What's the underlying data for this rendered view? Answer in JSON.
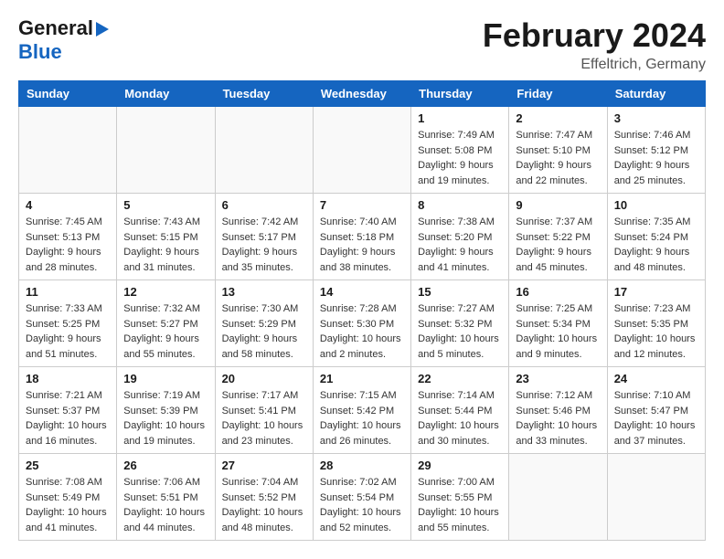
{
  "header": {
    "logo_general": "General",
    "logo_blue": "Blue",
    "main_title": "February 2024",
    "sub_title": "Effeltrich, Germany"
  },
  "weekdays": [
    "Sunday",
    "Monday",
    "Tuesday",
    "Wednesday",
    "Thursday",
    "Friday",
    "Saturday"
  ],
  "weeks": [
    [
      {
        "day": "",
        "info": ""
      },
      {
        "day": "",
        "info": ""
      },
      {
        "day": "",
        "info": ""
      },
      {
        "day": "",
        "info": ""
      },
      {
        "day": "1",
        "info": "Sunrise: 7:49 AM\nSunset: 5:08 PM\nDaylight: 9 hours\nand 19 minutes."
      },
      {
        "day": "2",
        "info": "Sunrise: 7:47 AM\nSunset: 5:10 PM\nDaylight: 9 hours\nand 22 minutes."
      },
      {
        "day": "3",
        "info": "Sunrise: 7:46 AM\nSunset: 5:12 PM\nDaylight: 9 hours\nand 25 minutes."
      }
    ],
    [
      {
        "day": "4",
        "info": "Sunrise: 7:45 AM\nSunset: 5:13 PM\nDaylight: 9 hours\nand 28 minutes."
      },
      {
        "day": "5",
        "info": "Sunrise: 7:43 AM\nSunset: 5:15 PM\nDaylight: 9 hours\nand 31 minutes."
      },
      {
        "day": "6",
        "info": "Sunrise: 7:42 AM\nSunset: 5:17 PM\nDaylight: 9 hours\nand 35 minutes."
      },
      {
        "day": "7",
        "info": "Sunrise: 7:40 AM\nSunset: 5:18 PM\nDaylight: 9 hours\nand 38 minutes."
      },
      {
        "day": "8",
        "info": "Sunrise: 7:38 AM\nSunset: 5:20 PM\nDaylight: 9 hours\nand 41 minutes."
      },
      {
        "day": "9",
        "info": "Sunrise: 7:37 AM\nSunset: 5:22 PM\nDaylight: 9 hours\nand 45 minutes."
      },
      {
        "day": "10",
        "info": "Sunrise: 7:35 AM\nSunset: 5:24 PM\nDaylight: 9 hours\nand 48 minutes."
      }
    ],
    [
      {
        "day": "11",
        "info": "Sunrise: 7:33 AM\nSunset: 5:25 PM\nDaylight: 9 hours\nand 51 minutes."
      },
      {
        "day": "12",
        "info": "Sunrise: 7:32 AM\nSunset: 5:27 PM\nDaylight: 9 hours\nand 55 minutes."
      },
      {
        "day": "13",
        "info": "Sunrise: 7:30 AM\nSunset: 5:29 PM\nDaylight: 9 hours\nand 58 minutes."
      },
      {
        "day": "14",
        "info": "Sunrise: 7:28 AM\nSunset: 5:30 PM\nDaylight: 10 hours\nand 2 minutes."
      },
      {
        "day": "15",
        "info": "Sunrise: 7:27 AM\nSunset: 5:32 PM\nDaylight: 10 hours\nand 5 minutes."
      },
      {
        "day": "16",
        "info": "Sunrise: 7:25 AM\nSunset: 5:34 PM\nDaylight: 10 hours\nand 9 minutes."
      },
      {
        "day": "17",
        "info": "Sunrise: 7:23 AM\nSunset: 5:35 PM\nDaylight: 10 hours\nand 12 minutes."
      }
    ],
    [
      {
        "day": "18",
        "info": "Sunrise: 7:21 AM\nSunset: 5:37 PM\nDaylight: 10 hours\nand 16 minutes."
      },
      {
        "day": "19",
        "info": "Sunrise: 7:19 AM\nSunset: 5:39 PM\nDaylight: 10 hours\nand 19 minutes."
      },
      {
        "day": "20",
        "info": "Sunrise: 7:17 AM\nSunset: 5:41 PM\nDaylight: 10 hours\nand 23 minutes."
      },
      {
        "day": "21",
        "info": "Sunrise: 7:15 AM\nSunset: 5:42 PM\nDaylight: 10 hours\nand 26 minutes."
      },
      {
        "day": "22",
        "info": "Sunrise: 7:14 AM\nSunset: 5:44 PM\nDaylight: 10 hours\nand 30 minutes."
      },
      {
        "day": "23",
        "info": "Sunrise: 7:12 AM\nSunset: 5:46 PM\nDaylight: 10 hours\nand 33 minutes."
      },
      {
        "day": "24",
        "info": "Sunrise: 7:10 AM\nSunset: 5:47 PM\nDaylight: 10 hours\nand 37 minutes."
      }
    ],
    [
      {
        "day": "25",
        "info": "Sunrise: 7:08 AM\nSunset: 5:49 PM\nDaylight: 10 hours\nand 41 minutes."
      },
      {
        "day": "26",
        "info": "Sunrise: 7:06 AM\nSunset: 5:51 PM\nDaylight: 10 hours\nand 44 minutes."
      },
      {
        "day": "27",
        "info": "Sunrise: 7:04 AM\nSunset: 5:52 PM\nDaylight: 10 hours\nand 48 minutes."
      },
      {
        "day": "28",
        "info": "Sunrise: 7:02 AM\nSunset: 5:54 PM\nDaylight: 10 hours\nand 52 minutes."
      },
      {
        "day": "29",
        "info": "Sunrise: 7:00 AM\nSunset: 5:55 PM\nDaylight: 10 hours\nand 55 minutes."
      },
      {
        "day": "",
        "info": ""
      },
      {
        "day": "",
        "info": ""
      }
    ]
  ]
}
